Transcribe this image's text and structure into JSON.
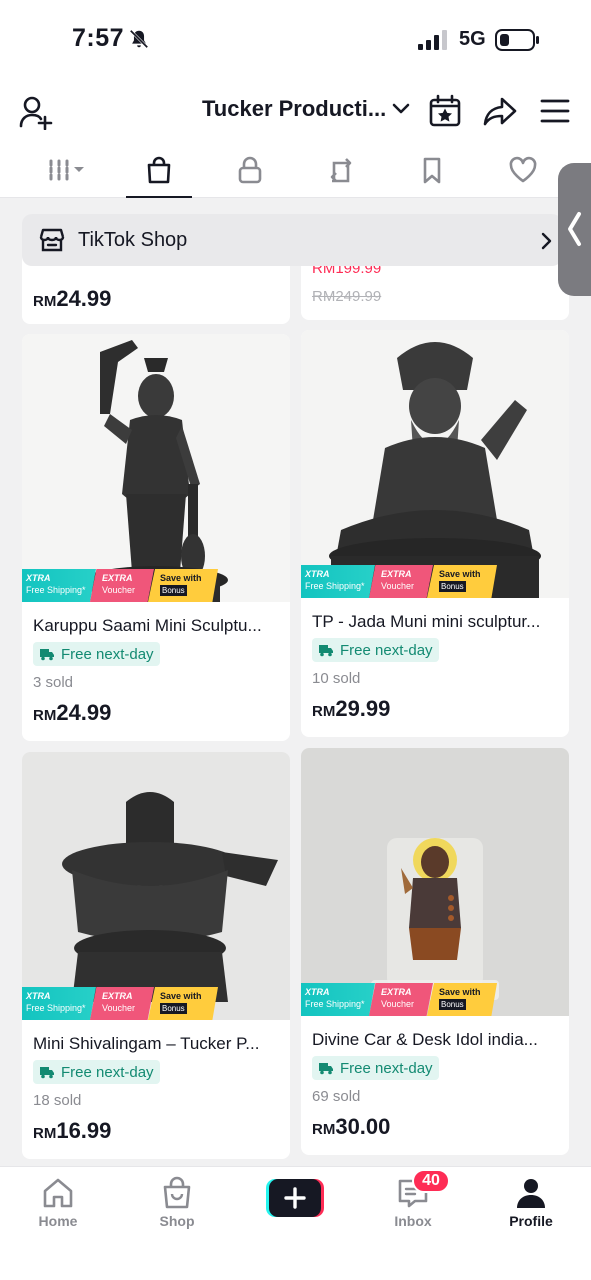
{
  "status_bar": {
    "time": "7:57",
    "network": "5G"
  },
  "header": {
    "title": "Tucker Producti..."
  },
  "shop_bar": {
    "label": "TikTok Shop"
  },
  "top_cards": [
    {
      "price_currency": "RM",
      "price_amount": "24.99"
    },
    {
      "price_partial": "RM199.99",
      "original_price": "RM249.99"
    }
  ],
  "products": [
    {
      "name": "Karuppu Saami Mini Sculptu...",
      "shipping": "Free next-day",
      "sold": "3 sold",
      "price_currency": "RM",
      "price_amount": "24.99"
    },
    {
      "name": "TP - Jada Muni mini sculptur...",
      "shipping": "Free next-day",
      "sold": "10 sold",
      "price_currency": "RM",
      "price_amount": "29.99"
    },
    {
      "name": "Mini Shivalingam – Tucker P...",
      "shipping": "Free next-day",
      "sold": "18 sold",
      "price_currency": "RM",
      "price_amount": "16.99"
    },
    {
      "name": "Divine Car & Desk Idol india...",
      "shipping": "Free next-day",
      "sold": "69 sold",
      "price_currency": "RM",
      "price_amount": "30.00"
    }
  ],
  "promo": {
    "xtra": "XTRA",
    "free_shipping": "Free Shipping*",
    "extra": "EXTRA",
    "voucher": "Voucher",
    "save_with": "Save with",
    "bonus": "Bonus"
  },
  "bottom_nav": {
    "home": "Home",
    "shop": "Shop",
    "inbox": "Inbox",
    "inbox_badge": "40",
    "profile": "Profile"
  }
}
